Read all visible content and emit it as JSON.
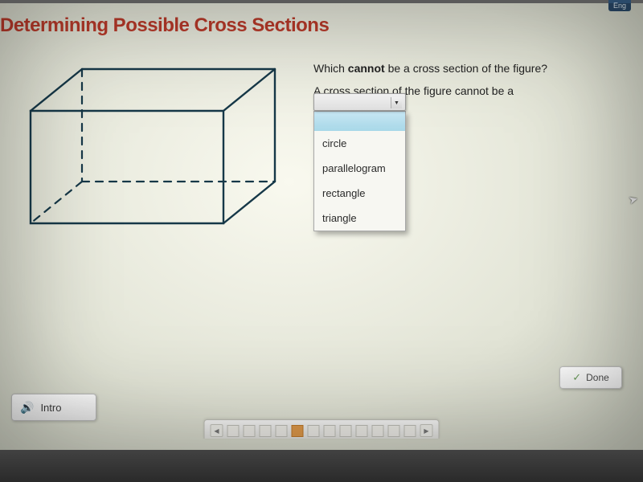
{
  "top_tab": "Eng",
  "title": "Determining Possible Cross Sections",
  "question": {
    "line1_pre": "Which ",
    "line1_bold": "cannot",
    "line1_post": " be a cross section of the figure?",
    "line2": "A cross section of the figure cannot be a"
  },
  "dropdown": {
    "selected": "",
    "options": [
      "",
      "circle",
      "parallelogram",
      "rectangle",
      "triangle"
    ]
  },
  "buttons": {
    "done": "Done",
    "intro": "Intro"
  },
  "nav": {
    "total": 12,
    "active_index": 4
  },
  "chart_data": {
    "type": "diagram",
    "shape": "rectangular_prism",
    "note": "3D box with dashed hidden edges; wireframe"
  }
}
